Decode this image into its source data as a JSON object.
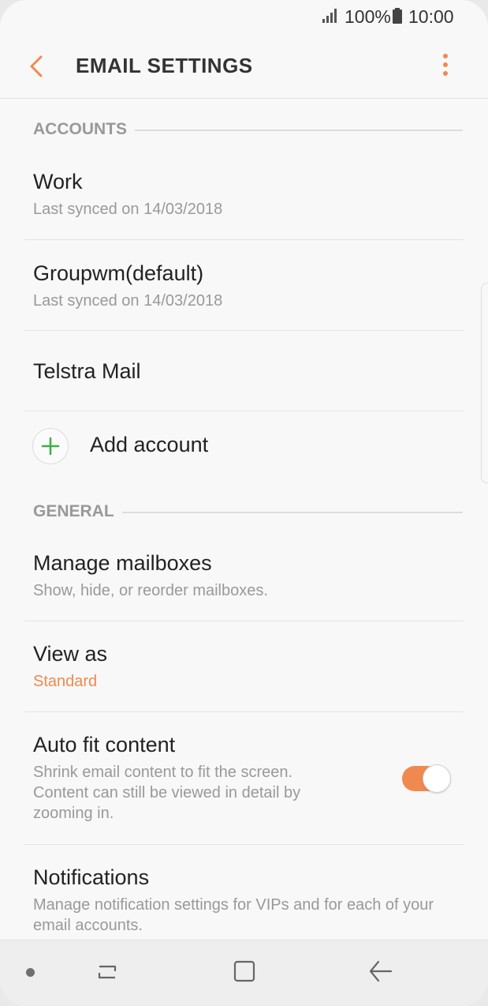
{
  "status_bar": {
    "battery_pct": "100%",
    "time": "10:00"
  },
  "app_bar": {
    "title": "EMAIL SETTINGS"
  },
  "sections": {
    "accounts": "ACCOUNTS",
    "general": "GENERAL"
  },
  "accounts": [
    {
      "name": "Work",
      "subtitle": "Last synced on 14/03/2018"
    },
    {
      "name": "Groupwm(default)",
      "subtitle": "Last synced on 14/03/2018"
    },
    {
      "name": "Telstra Mail"
    }
  ],
  "add_account": {
    "label": "Add account"
  },
  "general": {
    "manage_mailboxes": {
      "title": "Manage mailboxes",
      "subtitle": "Show, hide, or reorder mailboxes."
    },
    "view_as": {
      "title": "View as",
      "value": "Standard"
    },
    "auto_fit": {
      "title": "Auto fit content",
      "subtitle": "Shrink email content to fit the screen. Content can still be viewed in detail by zooming in.",
      "enabled": true
    },
    "notifications": {
      "title": "Notifications",
      "subtitle": "Manage notification settings for VIPs and for each of your email accounts."
    }
  },
  "icons": {
    "back": "back-arrow-icon",
    "more": "more-vertical-icon",
    "add": "plus-icon",
    "signal": "signal-icon",
    "battery": "battery-icon"
  },
  "colors": {
    "accent": "#f0894f",
    "add_icon": "#3cb043"
  }
}
